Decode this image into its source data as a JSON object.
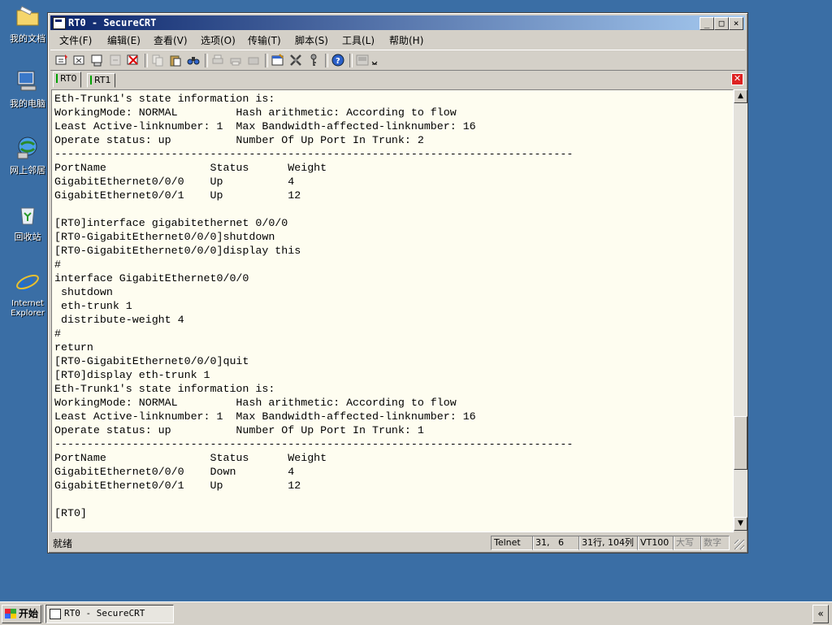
{
  "desktop": {
    "icons": [
      {
        "label": "我的文档",
        "icon": "folder-icon"
      },
      {
        "label": "我的电脑",
        "icon": "computer-icon"
      },
      {
        "label": "网上邻居",
        "icon": "network-icon"
      },
      {
        "label": "回收站",
        "icon": "recycle-bin-icon"
      },
      {
        "label": "Internet\nExplorer",
        "icon": "ie-icon"
      }
    ]
  },
  "window": {
    "title": "RT0 - SecureCRT",
    "controls": {
      "minimize": "_",
      "maximize": "□",
      "close": "×"
    }
  },
  "menu": [
    "文件(F)",
    "编辑(E)",
    "查看(V)",
    "选项(O)",
    "传输(T)",
    "脚本(S)",
    "工具(L)",
    "帮助(H)"
  ],
  "tabs": [
    {
      "label": "RT0",
      "active": true
    },
    {
      "label": "RT1",
      "active": false
    }
  ],
  "terminal": {
    "lines": [
      "Eth-Trunk1's state information is:",
      "WorkingMode: NORMAL         Hash arithmetic: According to flow",
      "Least Active-linknumber: 1  Max Bandwidth-affected-linknumber: 16",
      "Operate status: up          Number Of Up Port In Trunk: 2",
      "--------------------------------------------------------------------------------",
      "PortName                Status      Weight",
      "GigabitEthernet0/0/0    Up          4",
      "GigabitEthernet0/0/1    Up          12",
      "",
      "[RT0]interface gigabitethernet 0/0/0",
      "[RT0-GigabitEthernet0/0/0]shutdown",
      "[RT0-GigabitEthernet0/0/0]display this",
      "#",
      "interface GigabitEthernet0/0/0",
      " shutdown",
      " eth-trunk 1",
      " distribute-weight 4",
      "#",
      "return",
      "[RT0-GigabitEthernet0/0/0]quit",
      "[RT0]display eth-trunk 1",
      "Eth-Trunk1's state information is:",
      "WorkingMode: NORMAL         Hash arithmetic: According to flow",
      "Least Active-linknumber: 1  Max Bandwidth-affected-linknumber: 16",
      "Operate status: up          Number Of Up Port In Trunk: 1",
      "--------------------------------------------------------------------------------",
      "PortName                Status      Weight",
      "GigabitEthernet0/0/0    Down        4",
      "GigabitEthernet0/0/1    Up          12",
      "",
      "[RT0]"
    ]
  },
  "scrollbar": {
    "up": "▲",
    "down": "▼",
    "thumb_position_fraction": 0.87,
    "thumb_size_fraction": 0.13
  },
  "status": {
    "ready": "就绪",
    "protocol": "Telnet",
    "cursor": "31,   6",
    "size": "31行, 104列",
    "emulation": "VT100",
    "caps": "大写",
    "num": "数字"
  },
  "taskbar": {
    "start": "开始",
    "task": "RT0 - SecureCRT",
    "tray": "«"
  }
}
